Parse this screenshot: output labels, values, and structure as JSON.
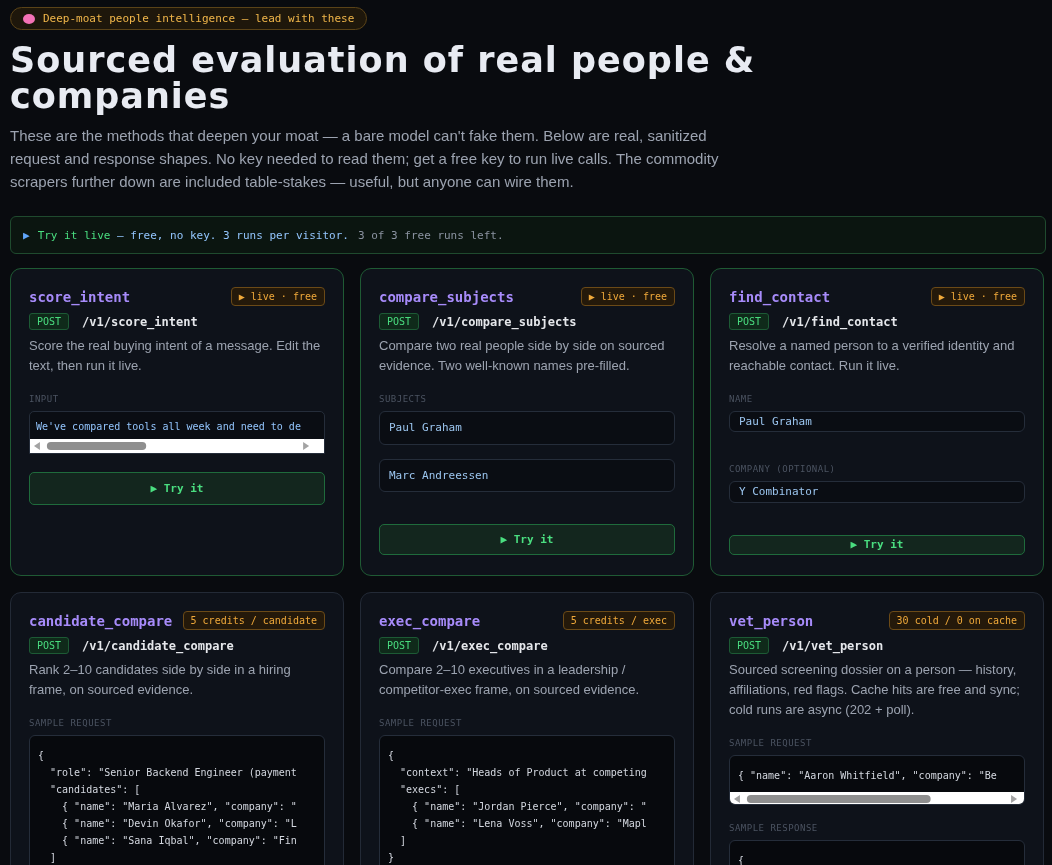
{
  "eyebrow": {
    "text": "Deep-moat people intelligence — lead with these"
  },
  "title": "Sourced evaluation of real people & companies",
  "intro": "These are the methods that deepen your moat — a bare model can't fake them. Below are real, sanitized request and response shapes. No key needed to read them; get a free key to run live calls. The commodity scrapers further down are included table-stakes — useful, but anyone can wire them.",
  "live_bar": {
    "icon": "▶",
    "lead": "Try it live",
    "rest": " — free, no key. 3 runs per visitor.",
    "status": "3 of 3 free runs left."
  },
  "cards": [
    {
      "name": "score_intent",
      "tag": "▶ live · free",
      "live": true,
      "method": "POST",
      "path": "/v1/score_intent",
      "description": "Score the real buying intent of a message. Edit the text, then run it live.",
      "sections": [
        {
          "kind": "textarea",
          "label": "INPUT",
          "value": "We've compared tools all week and need to de"
        }
      ],
      "button": {
        "icon": "▶",
        "label": "Try it"
      }
    },
    {
      "name": "compare_subjects",
      "tag": "▶ live · free",
      "live": true,
      "method": "POST",
      "path": "/v1/compare_subjects",
      "description": "Compare two real people side by side on sourced evidence. Two well-known names pre-filled.",
      "sections": [
        {
          "kind": "fields",
          "label": "SUBJECTS",
          "values": [
            "Paul Graham",
            "Marc Andreessen"
          ]
        }
      ],
      "button": {
        "icon": "▶",
        "label": "Try it"
      }
    },
    {
      "name": "find_contact",
      "tag": "▶ live · free",
      "live": true,
      "method": "POST",
      "path": "/v1/find_contact",
      "description": "Resolve a named person to a verified identity and reachable contact. Run it live.",
      "sections": [
        {
          "kind": "fields",
          "label": "NAME",
          "values": [
            "Paul Graham"
          ]
        },
        {
          "kind": "fields",
          "label": "COMPANY (OPTIONAL)",
          "values": [
            "Y Combinator"
          ]
        }
      ],
      "button": {
        "icon": "▶",
        "label": "Try it"
      }
    },
    {
      "name": "candidate_compare",
      "tag": "5 credits / candidate",
      "live": false,
      "method": "POST",
      "path": "/v1/candidate_compare",
      "description": "Rank 2–10 candidates side by side in a hiring frame, on sourced evidence.",
      "sections": [
        {
          "kind": "code",
          "label": "SAMPLE REQUEST",
          "lines": [
            "{",
            "  \"role\": \"Senior Backend Engineer (payment",
            "  \"candidates\": [",
            "    { \"name\": \"Maria Alvarez\", \"company\": \"",
            "    { \"name\": \"Devin Okafor\", \"company\": \"L",
            "    { \"name\": \"Sana Iqbal\", \"company\": \"Fin",
            "  ]"
          ]
        }
      ]
    },
    {
      "name": "exec_compare",
      "tag": "5 credits / exec",
      "live": false,
      "method": "POST",
      "path": "/v1/exec_compare",
      "description": "Compare 2–10 executives in a leadership / competitor-exec frame, on sourced evidence.",
      "sections": [
        {
          "kind": "code",
          "label": "SAMPLE REQUEST",
          "lines": [
            "{",
            "  \"context\": \"Heads of Product at competing",
            "  \"execs\": [",
            "    { \"name\": \"Jordan Pierce\", \"company\": \"",
            "    { \"name\": \"Lena Voss\", \"company\": \"Mapl",
            "  ]",
            "}"
          ]
        }
      ]
    },
    {
      "name": "vet_person",
      "tag": "30 cold / 0 on cache",
      "live": false,
      "method": "POST",
      "path": "/v1/vet_person",
      "description": "Sourced screening dossier on a person — history, affiliations, red flags. Cache hits are free and sync; cold runs are async (202 + poll).",
      "sections": [
        {
          "kind": "scrollcode",
          "label": "SAMPLE REQUEST",
          "lines": [
            "{ \"name\": \"Aaron Whitfield\", \"company\": \"Be"
          ]
        },
        {
          "kind": "code",
          "label": "SAMPLE RESPONSE",
          "lines": [
            "{"
          ]
        }
      ]
    }
  ]
}
